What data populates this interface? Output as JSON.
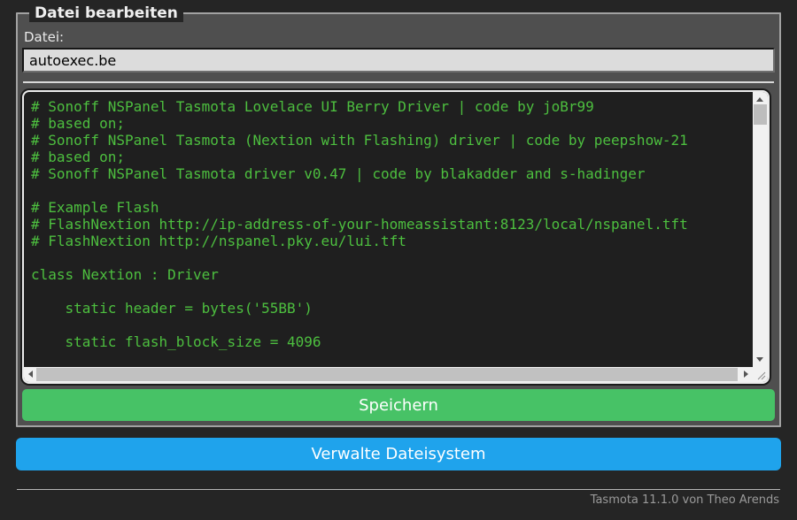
{
  "form": {
    "legend": "Datei bearbeiten",
    "file_label": "Datei:",
    "file_value": "autoexec.be",
    "editor_lines": [
      "# Sonoff NSPanel Tasmota Lovelace UI Berry Driver | code by joBr99",
      "# based on;",
      "# Sonoff NSPanel Tasmota (Nextion with Flashing) driver | code by peepshow-21",
      "# based on;",
      "# Sonoff NSPanel Tasmota driver v0.47 | code by blakadder and s-hadinger",
      "",
      "# Example Flash",
      "# FlashNextion http://ip-address-of-your-homeassistant:8123/local/nspanel.tft",
      "# FlashNextion http://nspanel.pky.eu/lui.tft",
      "",
      "class Nextion : Driver",
      "",
      "    static header = bytes('55BB')",
      "",
      "    static flash_block_size = 4096"
    ],
    "save_button": "Speichern"
  },
  "buttons": {
    "manage_filesystem": "Verwalte Dateisystem"
  },
  "footer": {
    "text": "Tasmota 11.1.0 von Theo Arends"
  },
  "colors": {
    "page_bg": "#252525",
    "fieldset_bg": "#4f4f4f",
    "editor_bg": "#1f1f1f",
    "code_text": "#4dbf3f",
    "input_bg": "#dcdcdc",
    "save_button_bg": "#47c266",
    "manage_button_bg": "#1fa3ec",
    "button_text": "#ffffff",
    "footer_text": "#9a9a9a"
  }
}
